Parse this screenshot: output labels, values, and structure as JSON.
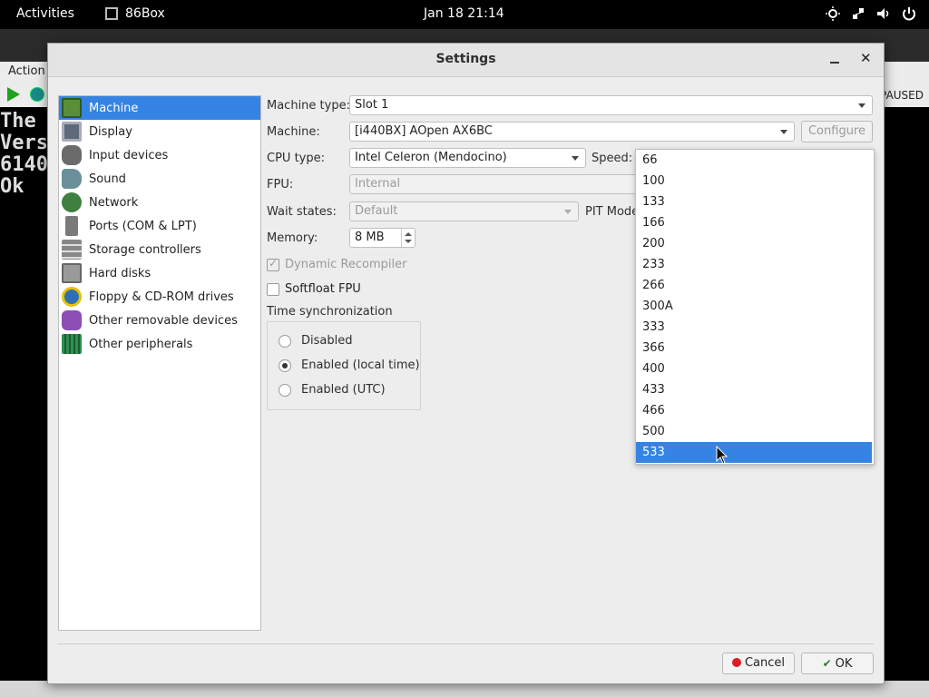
{
  "topbar": {
    "activities": "Activities",
    "app_name": "86Box",
    "clock": "Jan 18  21:14"
  },
  "bg_window": {
    "menu_action": "Action",
    "status": "PAUSED",
    "dos_lines": [
      "The",
      "Vers",
      "6140",
      "Ok"
    ]
  },
  "dialog": {
    "title": "Settings",
    "sidebar": [
      {
        "label": "Machine",
        "icon": "machine-icon",
        "color": "#5a8f3a"
      },
      {
        "label": "Display",
        "icon": "display-icon",
        "color": "#5d6a7a"
      },
      {
        "label": "Input devices",
        "icon": "input-devices-icon",
        "color": "#6b6b6b"
      },
      {
        "label": "Sound",
        "icon": "sound-icon",
        "color": "#6a8f9a"
      },
      {
        "label": "Network",
        "icon": "network-icon",
        "color": "#3f7f3f"
      },
      {
        "label": "Ports (COM & LPT)",
        "icon": "ports-icon",
        "color": "#7a7a7a"
      },
      {
        "label": "Storage controllers",
        "icon": "storage-controllers-icon",
        "color": "#888888"
      },
      {
        "label": "Hard disks",
        "icon": "hard-disks-icon",
        "color": "#9a9a9a"
      },
      {
        "label": "Floppy & CD-ROM drives",
        "icon": "floppy-cdrom-icon",
        "color": "#2f6fb5"
      },
      {
        "label": "Other removable devices",
        "icon": "removable-devices-icon",
        "color": "#8c4fb5"
      },
      {
        "label": "Other peripherals",
        "icon": "peripherals-icon",
        "color": "#2f8f4f"
      }
    ],
    "machine": {
      "machine_type_label": "Machine type:",
      "machine_type_value": "Slot 1",
      "machine_label": "Machine:",
      "machine_value": "[i440BX] AOpen AX6BC",
      "configure_label": "Configure",
      "cpu_type_label": "CPU type:",
      "cpu_type_value": "Intel Celeron (Mendocino)",
      "speed_label": "Speed:",
      "fpu_label": "FPU:",
      "fpu_value": "Internal",
      "wait_states_label": "Wait states:",
      "wait_states_value": "Default",
      "pit_mode_label": "PIT Mode",
      "memory_label": "Memory:",
      "memory_value": "8 MB",
      "dynamic_recompiler_label": "Dynamic Recompiler",
      "dynamic_recompiler_checked": true,
      "softfloat_label": "Softfloat FPU",
      "softfloat_checked": false,
      "time_sync_label": "Time synchronization",
      "time_sync_options": [
        "Disabled",
        "Enabled (local time)",
        "Enabled (UTC)"
      ],
      "time_sync_selected": "Enabled (local time)"
    },
    "speed_options": [
      "66",
      "100",
      "133",
      "166",
      "200",
      "233",
      "266",
      "300A",
      "333",
      "366",
      "400",
      "433",
      "466",
      "500",
      "533"
    ],
    "speed_selected": "533",
    "cancel_label": "Cancel",
    "ok_label": "OK"
  },
  "colors": {
    "accent": "#3584e4"
  }
}
